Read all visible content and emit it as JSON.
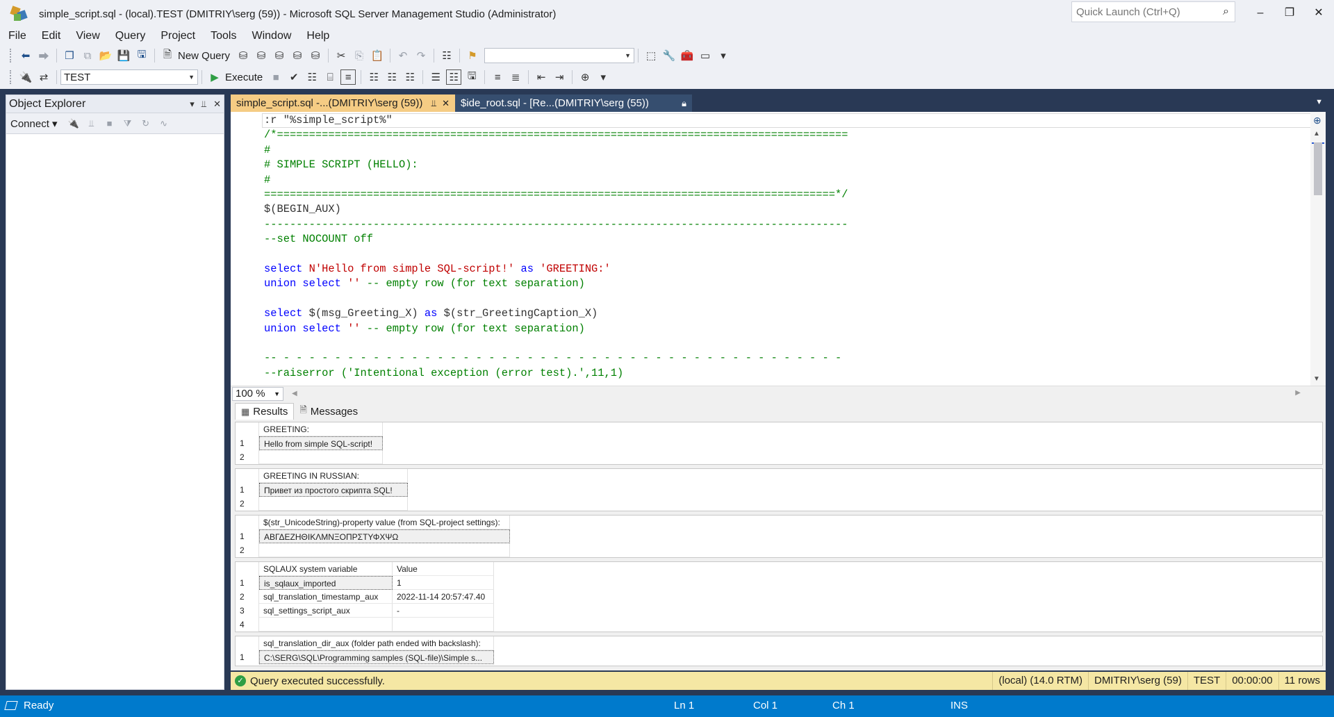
{
  "window": {
    "title": "simple_script.sql - (local).TEST (DMITRIY\\serg (59)) - Microsoft SQL Server Management Studio (Administrator)",
    "quick_launch_placeholder": "Quick Launch (Ctrl+Q)"
  },
  "menu": [
    "File",
    "Edit",
    "View",
    "Query",
    "Project",
    "Tools",
    "Window",
    "Help"
  ],
  "toolbar1": {
    "new_query_label": "New Query",
    "solution_config": ""
  },
  "toolbar2": {
    "database": "TEST",
    "execute_label": "Execute"
  },
  "object_explorer": {
    "title": "Object Explorer",
    "connect_label": "Connect"
  },
  "doc_tabs": [
    {
      "label": "simple_script.sql -...(DMITRIY\\serg (59))",
      "active": true
    },
    {
      "label": "$ide_root.sql -  [Re...(DMITRIY\\serg (55))",
      "active": false
    }
  ],
  "editor": {
    "lines": [
      [
        {
          "t": ":r \"%simple_script%\"",
          "c": "c-gray"
        }
      ],
      [
        {
          "t": "/*=========================================================================================",
          "c": "c-green"
        }
      ],
      [
        {
          "t": "#",
          "c": "c-green"
        }
      ],
      [
        {
          "t": "# SIMPLE SCRIPT (HELLO):",
          "c": "c-green"
        }
      ],
      [
        {
          "t": "#",
          "c": "c-green"
        }
      ],
      [
        {
          "t": "=========================================================================================*/",
          "c": "c-green"
        }
      ],
      [
        {
          "t": "$(BEGIN_AUX)",
          "c": "c-gray"
        }
      ],
      [
        {
          "t": "-------------------------------------------------------------------------------------------",
          "c": "c-green"
        }
      ],
      [
        {
          "t": "--set NOCOUNT off",
          "c": "c-green"
        }
      ],
      [],
      [
        {
          "t": "select ",
          "c": "c-blue"
        },
        {
          "t": "N'Hello from simple SQL-script!'",
          "c": "c-red"
        },
        {
          "t": " as ",
          "c": "c-blue"
        },
        {
          "t": "'GREETING:'",
          "c": "c-red"
        }
      ],
      [
        {
          "t": "union select ",
          "c": "c-blue"
        },
        {
          "t": "''",
          "c": "c-red"
        },
        {
          "t": " -- empty row (for text separation)",
          "c": "c-green"
        }
      ],
      [],
      [
        {
          "t": "select ",
          "c": "c-blue"
        },
        {
          "t": "$(msg_Greeting_X)",
          "c": "c-gray"
        },
        {
          "t": " as ",
          "c": "c-blue"
        },
        {
          "t": "$(str_GreetingCaption_X)",
          "c": "c-gray"
        }
      ],
      [
        {
          "t": "union select ",
          "c": "c-blue"
        },
        {
          "t": "''",
          "c": "c-red"
        },
        {
          "t": " -- empty row (for text separation)",
          "c": "c-green"
        }
      ],
      [],
      [
        {
          "t": "-- - - - - - - - - - - - - - - - - - - - - - - - - - - - - - - - - - - - - - - - - - - - -",
          "c": "c-green"
        }
      ],
      [
        {
          "t": "--raiserror ('Intentional exception (error test).',11,1)",
          "c": "c-green"
        }
      ]
    ]
  },
  "zoom": "100 %",
  "results_tabs": {
    "results": "Results",
    "messages": "Messages"
  },
  "grids": [
    {
      "headers": [
        "GREETING:"
      ],
      "rows": [
        [
          "Hello from simple SQL-script!"
        ],
        [
          ""
        ]
      ],
      "rownums": [
        "1",
        "2"
      ]
    },
    {
      "headers": [
        "GREETING IN RUSSIAN:"
      ],
      "rows": [
        [
          "Привет из простого скрипта SQL!"
        ],
        [
          ""
        ]
      ],
      "rownums": [
        "1",
        "2"
      ]
    },
    {
      "headers": [
        "$(str_UnicodeString)-property value (from SQL-project settings):"
      ],
      "rows": [
        [
          "ΑΒΓΔΕΖΗΘΙΚΛΜΝΞΟΠΡΣΤΥΦΧΨΩ"
        ],
        [
          ""
        ]
      ],
      "rownums": [
        "1",
        "2"
      ]
    },
    {
      "headers": [
        "SQLAUX system variable",
        "Value"
      ],
      "rows": [
        [
          "is_sqlaux_imported",
          "1"
        ],
        [
          "sql_translation_timestamp_aux",
          "2022-11-14 20:57:47.40"
        ],
        [
          "sql_settings_script_aux",
          "-"
        ],
        [
          "",
          ""
        ]
      ],
      "rownums": [
        "1",
        "2",
        "3",
        "4"
      ]
    },
    {
      "headers": [
        "sql_translation_dir_aux (folder path ended with backslash):"
      ],
      "rows": [
        [
          "C:\\SERG\\SQL\\Programming samples (SQL-file)\\Simple s..."
        ]
      ],
      "rownums": [
        "1"
      ]
    }
  ],
  "query_status": {
    "message": "Query executed successfully.",
    "server": "(local) (14.0 RTM)",
    "user": "DMITRIY\\serg (59)",
    "database": "TEST",
    "elapsed": "00:00:00",
    "rows": "11 rows"
  },
  "statusbar": {
    "ready": "Ready",
    "ln": "Ln 1",
    "col": "Col 1",
    "ch": "Ch 1",
    "ins": "INS"
  },
  "colors": {
    "accent_blue": "#007acc",
    "dark_band": "#293955",
    "active_tab": "#f5cc84",
    "query_status_bg": "#f5e7a4"
  }
}
